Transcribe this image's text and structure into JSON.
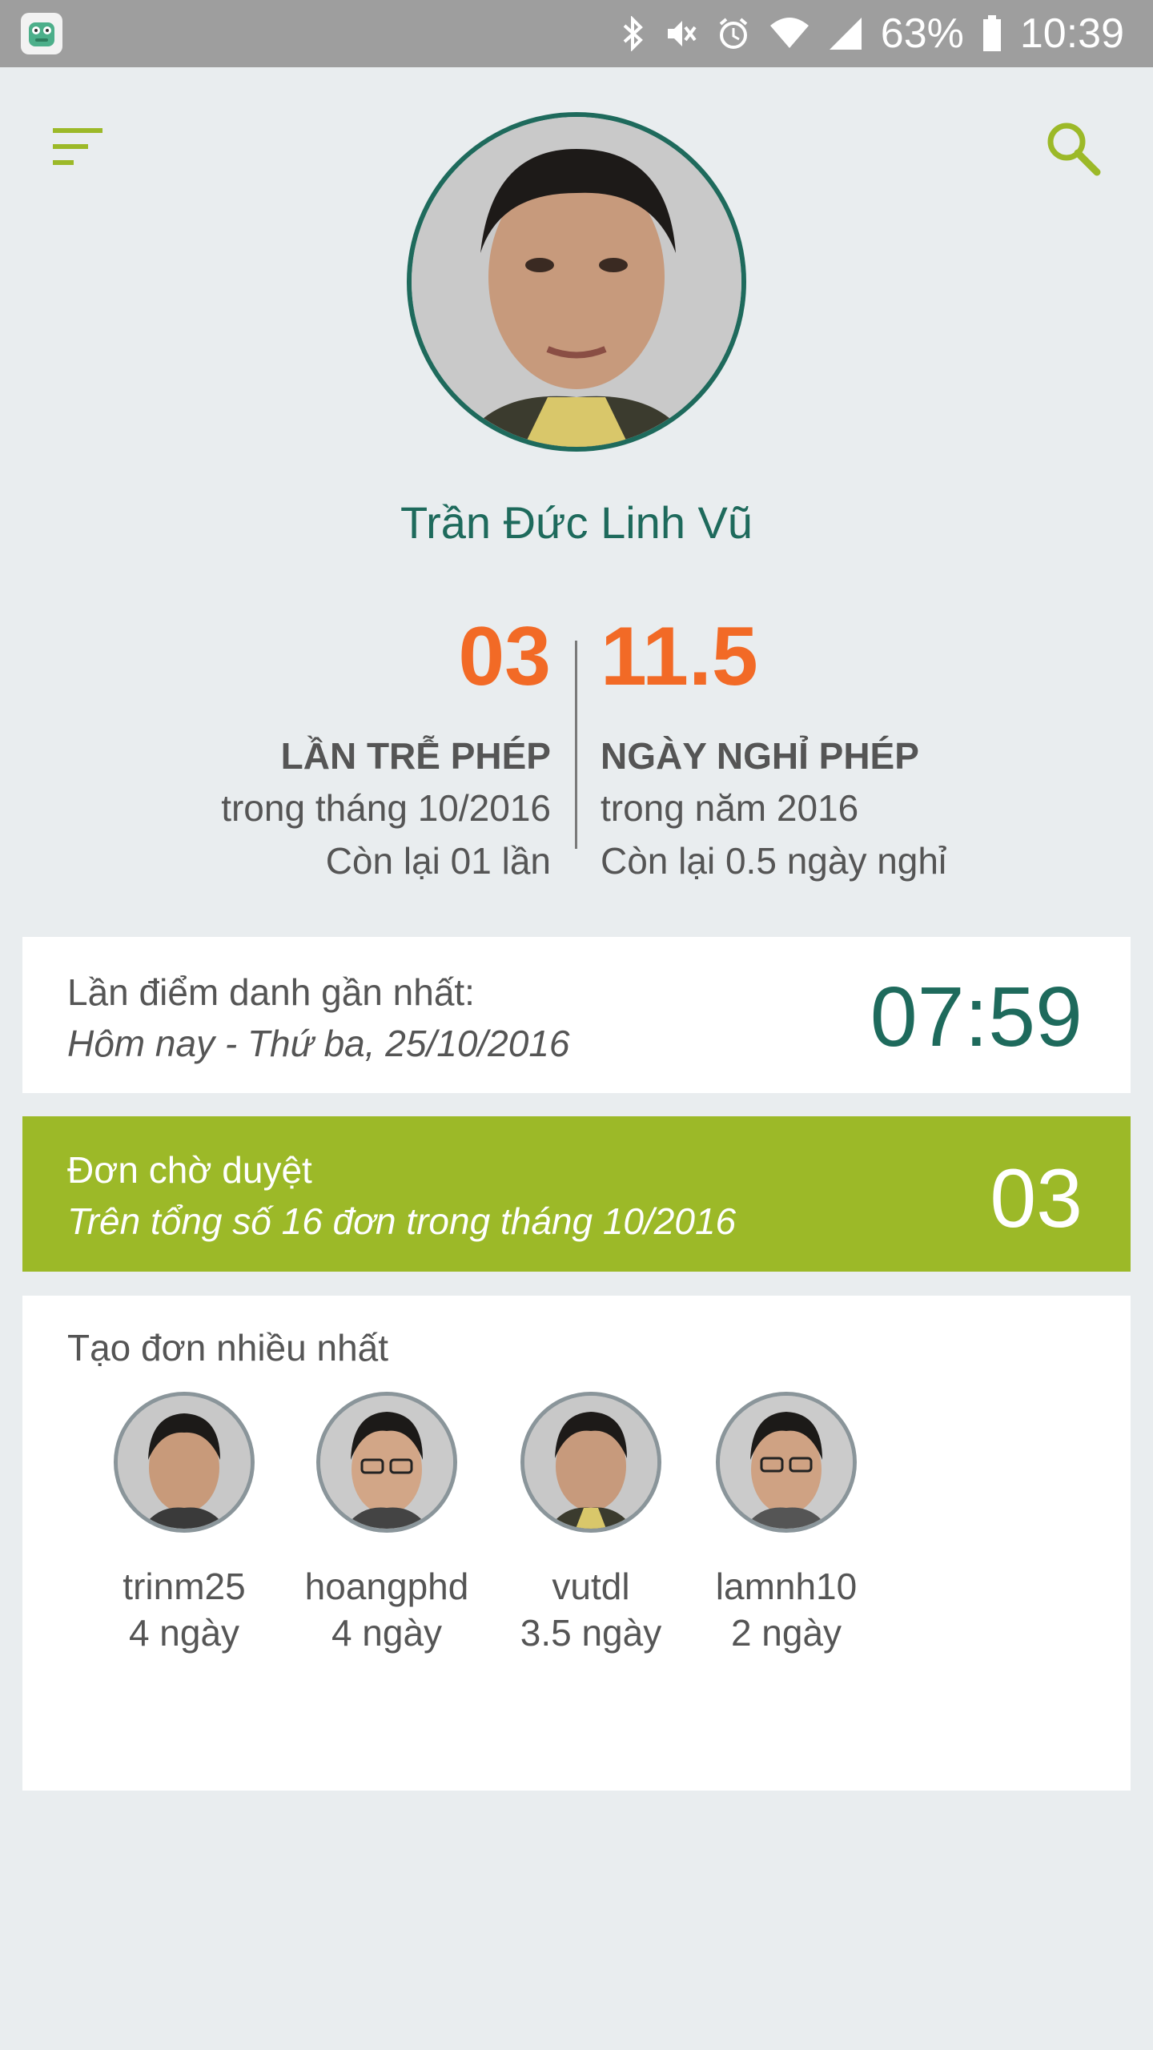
{
  "status_bar": {
    "battery": "63%",
    "time": "10:39",
    "icons": [
      "app-icon",
      "bluetooth-icon",
      "mute-icon",
      "alarm-icon",
      "wifi-icon",
      "signal-icon",
      "battery-icon"
    ]
  },
  "header": {
    "menu_icon": "menu-icon",
    "search_icon": "search-icon"
  },
  "profile": {
    "name": "Trần Đức Linh Vũ"
  },
  "stats": {
    "late": {
      "value": "03",
      "title": "LẦN TRỄ PHÉP",
      "period": "trong tháng 10/2016",
      "remaining": "Còn lại 01 lần"
    },
    "leave": {
      "value": "11.5",
      "title": "NGÀY NGHỈ PHÉP",
      "period": "trong năm 2016",
      "remaining": "Còn lại 0.5 ngày nghỉ"
    }
  },
  "checkin": {
    "label": "Lần điểm danh gần nhất:",
    "date": "Hôm nay - Thứ ba, 25/10/2016",
    "time": "07:59"
  },
  "pending": {
    "label": "Đơn chờ duyệt",
    "subtitle": "Trên tổng số 16 đơn trong tháng 10/2016",
    "count": "03"
  },
  "top_requesters": {
    "title": "Tạo đơn nhiều nhất",
    "people": [
      {
        "username": "trinm25",
        "days": "4 ngày"
      },
      {
        "username": "hoangphd",
        "days": "4 ngày"
      },
      {
        "username": "vutdl",
        "days": "3.5 ngày"
      },
      {
        "username": "lamnh10",
        "days": "2 ngày"
      }
    ]
  },
  "colors": {
    "accent_green": "#9cb928",
    "teal": "#1e6a5c",
    "orange": "#f26a26",
    "status_bar": "#9e9e9e",
    "background": "#e9edef"
  }
}
